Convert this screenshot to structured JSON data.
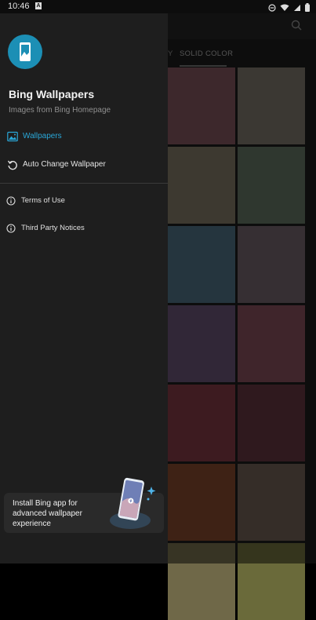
{
  "status_bar": {
    "time": "10:46",
    "notification_icon": "A"
  },
  "background_app": {
    "tabs": {
      "partial_tab_label": "Y",
      "active_tab_label": "SOLID COLOR"
    },
    "swatch_colors": [
      [
        "#7a5058",
        "#777066"
      ],
      [
        "#7b7360",
        "#5f6e5e"
      ],
      [
        "#4a6a7c",
        "#6c5f66"
      ],
      [
        "#634f6e",
        "#7e4a56"
      ],
      [
        "#7a3640",
        "#5f333d"
      ],
      [
        "#7d452b",
        "#6a5a50"
      ],
      [
        "#6f6848",
        "#6a6a3a"
      ]
    ]
  },
  "drawer": {
    "app_title": "Bing Wallpapers",
    "app_subtitle": "Images from Bing Homepage",
    "nav": [
      {
        "label": "Wallpapers",
        "icon": "image-icon",
        "active": true
      },
      {
        "label": "Auto Change Wallpaper",
        "icon": "refresh-icon",
        "active": false
      }
    ],
    "info": [
      {
        "label": "Terms of Use",
        "icon": "info-icon"
      },
      {
        "label": "Third Party Notices",
        "icon": "info-icon"
      }
    ],
    "promo": {
      "text": "Install Bing app for advanced wallpaper experience"
    }
  },
  "colors": {
    "accent": "#2aa7d8",
    "drawer_bg": "#1e1e1e"
  }
}
